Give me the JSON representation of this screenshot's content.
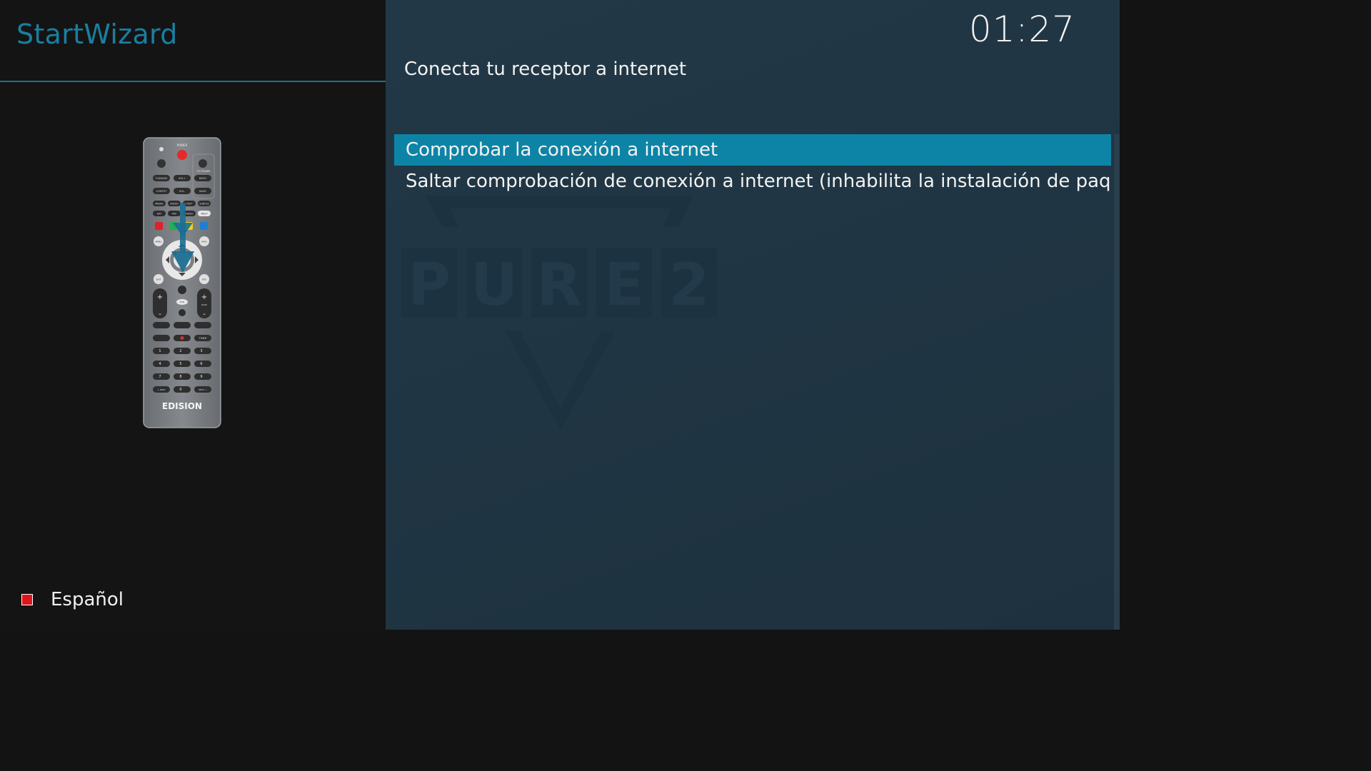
{
  "header": {
    "title": "StartWizard"
  },
  "clock": {
    "time": "01:27"
  },
  "step": {
    "instruction": "Conecta tu receptor a internet"
  },
  "menu": {
    "items": [
      {
        "label": "Comprobar la conexión a internet",
        "selected": true
      },
      {
        "label": "Saltar comprobación de conexión a internet (inhabilita la instalación de paquetes",
        "selected": false
      }
    ]
  },
  "remote": {
    "brand": "EDISION",
    "key_labels": [
      "POWER",
      "TV POWER",
      "TV/RADIO",
      "VOL+",
      "RATIO",
      "CONTXT",
      "VOL-",
      "BACK",
      "MEDIA",
      "AUDIO",
      "TEXT",
      "SUBTLE",
      "SAT",
      "FAV",
      "VIDEO",
      "HELP",
      "MENU",
      "INFO",
      "EXIT",
      "EPG",
      "PAGE",
      "PVR",
      "TIMER",
      "< PREV",
      "NEXT >"
    ]
  },
  "watermark": {
    "text": "PURE2"
  },
  "language": {
    "label": "Español",
    "flag_color": "#e0141b"
  },
  "colors": {
    "accent": "#0d84a6",
    "title": "#1a7fa0",
    "remote_arrow": "#1b6f93"
  }
}
